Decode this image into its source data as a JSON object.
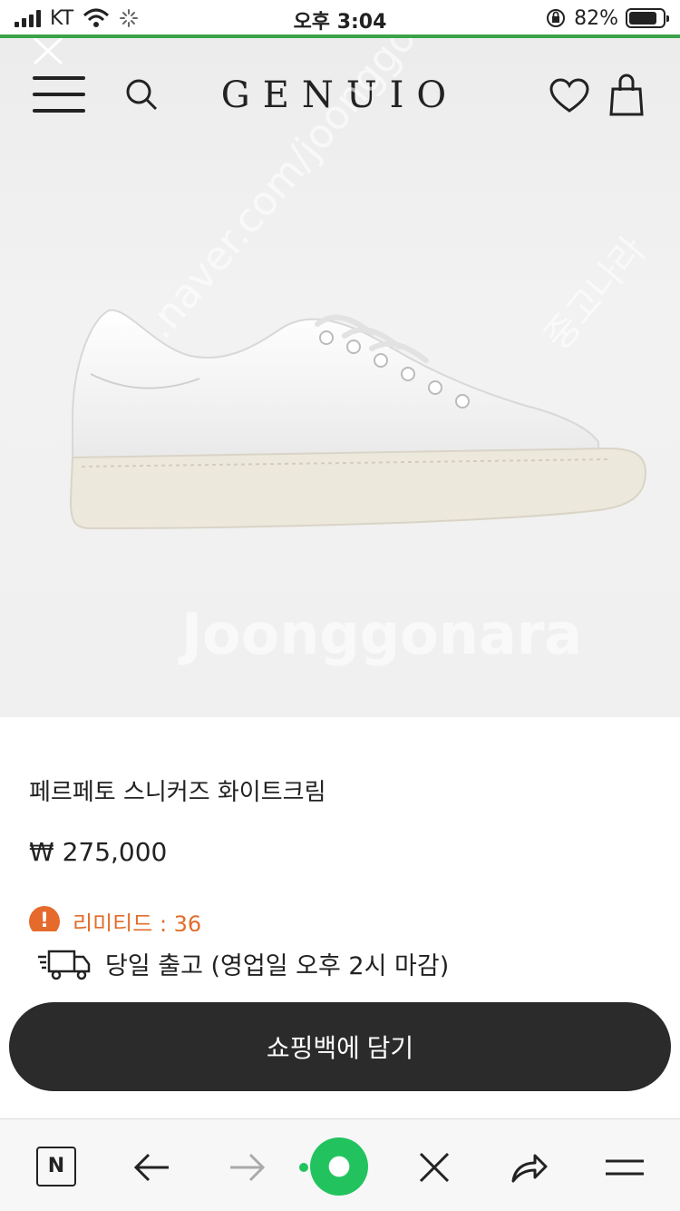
{
  "status_bar": {
    "carrier": "KT",
    "time": "오후 3:04",
    "battery": "82%",
    "battery_level": 0.82
  },
  "header": {
    "brand": "GENUIO",
    "icons": [
      "close-icon",
      "hamburger-menu-icon",
      "search-icon",
      "heart-icon",
      "shopping-bag-icon"
    ]
  },
  "watermark": {
    "brand": "Joonggonara",
    "korean": "중고나라",
    "url": "cafe.naver.com/joonggonara"
  },
  "product": {
    "name": "페르페토 스니커즈 화이트크림",
    "price": "₩ 275,000",
    "limited_label": "리미티드 : 36",
    "warning_icon_glyph": "!",
    "shipping": "당일 출고 (영업일 오후 2시 마감)",
    "cart_button": "쇼핑백에 담기"
  },
  "browser_bar": {
    "home_label": "N",
    "icons": [
      "naver-home-icon",
      "back-arrow-icon",
      "forward-arrow-icon",
      "green-dot-icon",
      "close-icon",
      "share-icon",
      "menu-icon"
    ]
  },
  "colors": {
    "accent_orange": "#e56a2c",
    "button_dark": "#2b2b2b",
    "green": "#22c35e",
    "load_line": "#3aa34a"
  }
}
